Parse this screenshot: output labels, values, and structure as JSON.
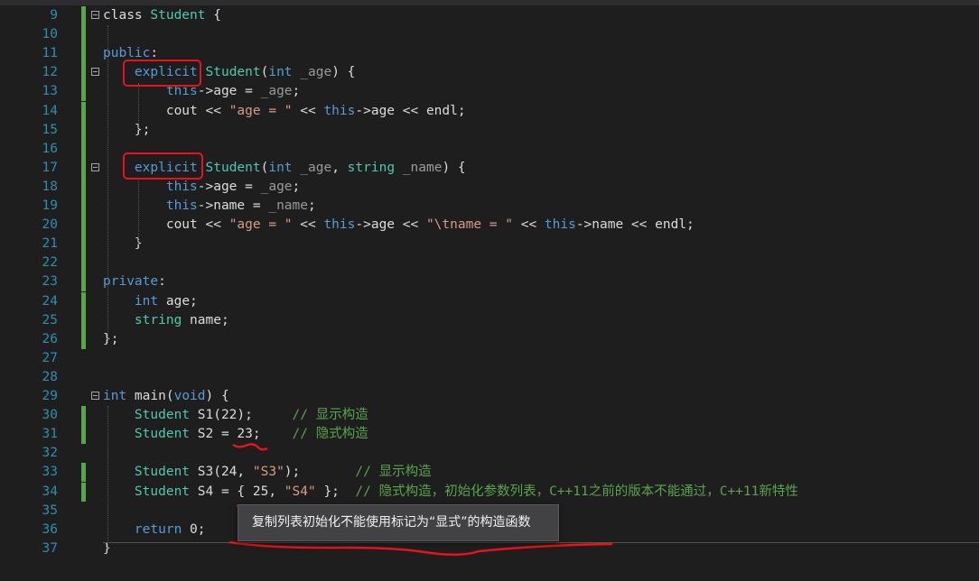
{
  "editor": {
    "lines": [
      {
        "n": "9",
        "parts": [
          [
            "p",
            "class "
          ],
          [
            "t",
            "Student"
          ],
          [
            "p",
            " {"
          ]
        ]
      },
      {
        "n": "10",
        "parts": []
      },
      {
        "n": "11",
        "parts": [
          [
            "k",
            "public"
          ],
          [
            "p",
            ":"
          ]
        ]
      },
      {
        "n": "12",
        "parts": [
          [
            "p",
            "    "
          ],
          [
            "k",
            "explicit"
          ],
          [
            "p",
            " "
          ],
          [
            "t",
            "Student"
          ],
          [
            "p",
            "("
          ],
          [
            "k",
            "int"
          ],
          [
            "p",
            " "
          ],
          [
            "m",
            "_age"
          ],
          [
            "p",
            ") {"
          ]
        ]
      },
      {
        "n": "13",
        "parts": [
          [
            "p",
            "        "
          ],
          [
            "k",
            "this"
          ],
          [
            "p",
            "->age = "
          ],
          [
            "m",
            "_age"
          ],
          [
            "p",
            ";"
          ]
        ]
      },
      {
        "n": "14",
        "parts": [
          [
            "p",
            "        cout << "
          ],
          [
            "s",
            "\"age = \""
          ],
          [
            "p",
            " << "
          ],
          [
            "k",
            "this"
          ],
          [
            "p",
            "->age << endl;"
          ]
        ]
      },
      {
        "n": "15",
        "parts": [
          [
            "p",
            "    };"
          ]
        ]
      },
      {
        "n": "16",
        "parts": []
      },
      {
        "n": "17",
        "parts": [
          [
            "p",
            "    "
          ],
          [
            "k",
            "explicit"
          ],
          [
            "p",
            " "
          ],
          [
            "t",
            "Student"
          ],
          [
            "p",
            "("
          ],
          [
            "k",
            "int"
          ],
          [
            "p",
            " "
          ],
          [
            "m",
            "_age"
          ],
          [
            "p",
            ", "
          ],
          [
            "t",
            "string"
          ],
          [
            "p",
            " "
          ],
          [
            "m",
            "_name"
          ],
          [
            "p",
            ") {"
          ]
        ]
      },
      {
        "n": "18",
        "parts": [
          [
            "p",
            "        "
          ],
          [
            "k",
            "this"
          ],
          [
            "p",
            "->age = "
          ],
          [
            "m",
            "_age"
          ],
          [
            "p",
            ";"
          ]
        ]
      },
      {
        "n": "19",
        "parts": [
          [
            "p",
            "        "
          ],
          [
            "k",
            "this"
          ],
          [
            "p",
            "->name = "
          ],
          [
            "m",
            "_name"
          ],
          [
            "p",
            ";"
          ]
        ]
      },
      {
        "n": "20",
        "parts": [
          [
            "p",
            "        cout << "
          ],
          [
            "s",
            "\"age = \""
          ],
          [
            "p",
            " << "
          ],
          [
            "k",
            "this"
          ],
          [
            "p",
            "->age << "
          ],
          [
            "s",
            "\"\\tname = \""
          ],
          [
            "p",
            " << "
          ],
          [
            "k",
            "this"
          ],
          [
            "p",
            "->name << endl;"
          ]
        ]
      },
      {
        "n": "21",
        "parts": [
          [
            "p",
            "    }"
          ]
        ]
      },
      {
        "n": "22",
        "parts": []
      },
      {
        "n": "23",
        "parts": [
          [
            "k",
            "private"
          ],
          [
            "p",
            ":"
          ]
        ]
      },
      {
        "n": "24",
        "parts": [
          [
            "p",
            "    "
          ],
          [
            "k",
            "int"
          ],
          [
            "p",
            " age;"
          ]
        ]
      },
      {
        "n": "25",
        "parts": [
          [
            "p",
            "    "
          ],
          [
            "t",
            "string"
          ],
          [
            "p",
            " name;"
          ]
        ]
      },
      {
        "n": "26",
        "parts": [
          [
            "p",
            "};"
          ]
        ]
      },
      {
        "n": "27",
        "parts": []
      },
      {
        "n": "28",
        "parts": []
      },
      {
        "n": "29",
        "parts": [
          [
            "k",
            "int"
          ],
          [
            "p",
            " main("
          ],
          [
            "k",
            "void"
          ],
          [
            "p",
            ") {"
          ]
        ]
      },
      {
        "n": "30",
        "parts": [
          [
            "p",
            "    "
          ],
          [
            "t",
            "Student"
          ],
          [
            "p",
            " S1(22);     "
          ],
          [
            "c",
            "// 显示构造"
          ]
        ]
      },
      {
        "n": "31",
        "parts": [
          [
            "p",
            "    "
          ],
          [
            "t",
            "Student"
          ],
          [
            "p",
            " S2 = 23;    "
          ],
          [
            "c",
            "// 隐式构造"
          ]
        ]
      },
      {
        "n": "32",
        "parts": []
      },
      {
        "n": "33",
        "parts": [
          [
            "p",
            "    "
          ],
          [
            "t",
            "Student"
          ],
          [
            "p",
            " S3(24, "
          ],
          [
            "s",
            "\"S3\""
          ],
          [
            "p",
            ");       "
          ],
          [
            "c",
            "// 显示构造"
          ]
        ]
      },
      {
        "n": "34",
        "parts": [
          [
            "p",
            "    "
          ],
          [
            "t",
            "Student"
          ],
          [
            "p",
            " S4 = { 25, "
          ],
          [
            "s",
            "\"S4\""
          ],
          [
            "p",
            " };  "
          ],
          [
            "c",
            "// 隐式构造，初始化参数列表，C++11之前的版本不能通过，C++11新特性"
          ]
        ]
      },
      {
        "n": "35",
        "parts": []
      },
      {
        "n": "36",
        "parts": [
          [
            "p",
            "    "
          ],
          [
            "k",
            "return"
          ],
          [
            "p",
            " 0;"
          ]
        ]
      },
      {
        "n": "37",
        "parts": [
          [
            "p",
            "}"
          ]
        ]
      }
    ]
  },
  "tooltip": {
    "text": "复制列表初始化不能使用标记为“显式”的构造函数"
  },
  "colors": {
    "background": "#1e1e1e",
    "keyword": "#569cd6",
    "type": "#4ec9b0",
    "string": "#d69d85",
    "comment": "#57a64a",
    "line_number": "#2b91af",
    "annotation": "#e8141b"
  }
}
